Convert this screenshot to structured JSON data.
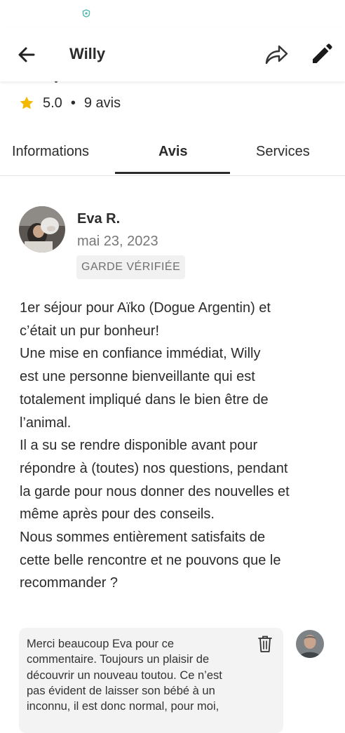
{
  "header": {
    "title": "Willy"
  },
  "rating": {
    "value": "5.0",
    "separator": "•",
    "count_label": "9 avis"
  },
  "tabs": [
    {
      "label": "Informations",
      "active": false
    },
    {
      "label": "Avis",
      "active": true
    },
    {
      "label": "Services",
      "active": false
    }
  ],
  "review": {
    "author": "Eva R.",
    "date": "mai 23, 2023",
    "badge": "GARDE VÉRIFIÉE",
    "lines": [
      "1er séjour pour Aïko (Dogue Argentin) et",
      "c’était un pur bonheur!",
      "Une mise en confiance immédiat, Willy",
      "est une personne bienveillante qui est",
      "totalement impliqué dans le bien être de",
      "l’animal.",
      "Il a su se rendre disponible avant pour",
      "répondre à (toutes) nos questions, pendant",
      "la garde pour nous donner des nouvelles et",
      "même après pour des conseils.",
      "Nous sommes entièrement satisfaits de",
      "cette belle rencontre et ne pouvons que le",
      "recommander ?"
    ]
  },
  "reply": {
    "lines": [
      "Merci beaucoup Eva pour ce",
      "commentaire. Toujours un plaisir de",
      "découvrir un nouveau toutou. Ce n’est",
      "pas évident de laisser son bébé à un",
      "inconnu, il est donc normal, pour moi,"
    ]
  },
  "icons": {
    "back": "arrow-back-icon",
    "share": "share-icon",
    "edit": "pencil-icon",
    "star": "star-icon",
    "delete": "trash-icon"
  },
  "colors": {
    "star": "#F5B800",
    "text": "#2B2B2B",
    "muted": "#777777",
    "badge_bg": "#F1F1F1",
    "reply_bg": "#F3F3F3"
  }
}
